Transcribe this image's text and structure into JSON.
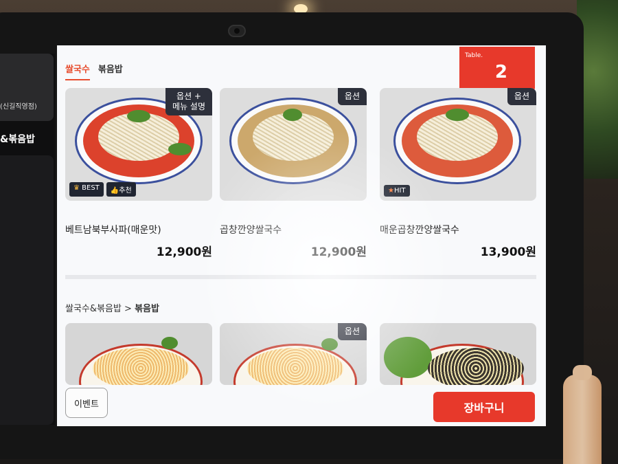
{
  "app": {
    "accent": "#e2382a",
    "dark_badge": "#2c2f3a"
  },
  "sidebar_preview": {
    "store_name": "(신길직영점)",
    "category": "&볶음밥"
  },
  "tabs": [
    {
      "label": "쌀국수",
      "active": true
    },
    {
      "label": "볶음밥",
      "active": false
    }
  ],
  "table": {
    "label": "Table.",
    "number": "2"
  },
  "section1": {
    "items": [
      {
        "name": "베트남북부사파(매운맛)",
        "price": "12,900원",
        "badge_line1": "옵션 +",
        "badge_line2": "메뉴 설명",
        "tags": [
          "BEST",
          "추천"
        ],
        "broth": "#d8412b"
      },
      {
        "name": "곱창깐양쌀국수",
        "price": "12,900원",
        "badge_line1": "옵션",
        "badge_line2": "",
        "tags": [],
        "broth": "#c8a56a"
      },
      {
        "name": "매운곱창깐양쌀국수",
        "price": "13,900원",
        "badge_line1": "옵션",
        "badge_line2": "",
        "tags": [
          "HIT"
        ],
        "broth": "#d9593b"
      }
    ]
  },
  "section2": {
    "breadcrumb_parent": "쌀국수&볶음밥",
    "breadcrumb_sep": ">",
    "breadcrumb_current": "볶음밥",
    "items": [
      {
        "badge": ""
      },
      {
        "badge": "옵션"
      },
      {
        "badge": ""
      }
    ]
  },
  "footer": {
    "event_label": "이벤트",
    "cart_label": "장바구니"
  }
}
